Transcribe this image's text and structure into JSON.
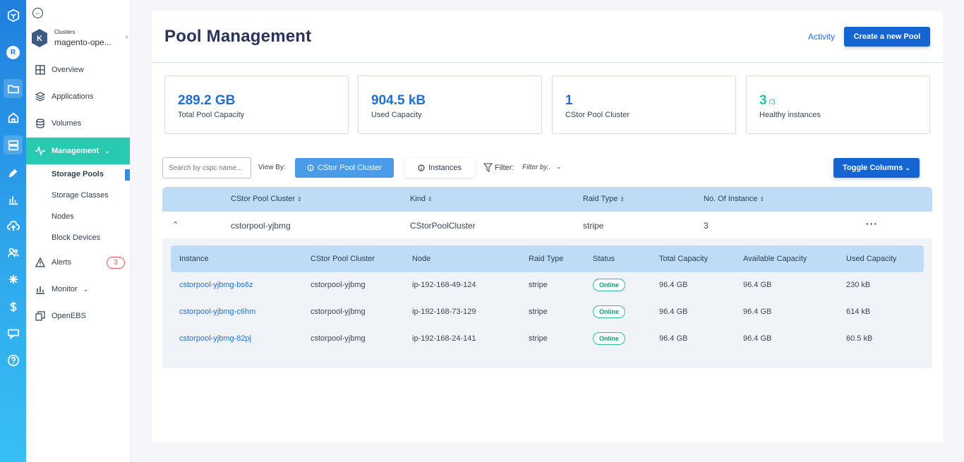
{
  "rail": {
    "avatar": "R",
    "items": [
      "logo-icon",
      "folder-icon",
      "home-icon",
      "server-icon",
      "satellite-icon",
      "bar-chart-icon",
      "cloud-upload-icon",
      "users-icon",
      "bug-icon",
      "dollar-icon",
      "chat-icon",
      "help-icon"
    ]
  },
  "sidebar": {
    "cluster_small": "Clusters",
    "cluster_name": "magento-ope...",
    "items": [
      {
        "label": "Overview",
        "icon": "grid-icon"
      },
      {
        "label": "Applications",
        "icon": "layers-icon"
      },
      {
        "label": "Volumes",
        "icon": "database-icon"
      },
      {
        "label": "Management",
        "icon": "pulse-icon"
      },
      {
        "label": "Alerts",
        "icon": "warning-icon"
      },
      {
        "label": "Monitor",
        "icon": "chart-icon"
      },
      {
        "label": "OpenEBS",
        "icon": "copy-icon"
      }
    ],
    "sub": [
      "Storage Pools",
      "Storage Classes",
      "Nodes",
      "Block Devices"
    ],
    "alerts_count": "3"
  },
  "header": {
    "title": "Pool Management",
    "activity": "Activity",
    "create": "Create a new Pool"
  },
  "stats": [
    {
      "value": "289.2 GB",
      "suffix": "",
      "label": "Total Pool Capacity"
    },
    {
      "value": "904.5 kB",
      "suffix": "",
      "label": "Used Capacity"
    },
    {
      "value": "1",
      "suffix": "",
      "label": "CStor Pool Cluster"
    },
    {
      "value": "3",
      "suffix": " /3",
      "label": "Healthy instances"
    }
  ],
  "toolbar": {
    "search_placeholder": "Search by cspc name...",
    "view_by": "View By:",
    "view_cluster": "CStor Pool Cluster",
    "view_instances": "Instances",
    "filter": "Filter:",
    "filter_value": "Filter by..",
    "toggle": "Toggle Columns"
  },
  "table": {
    "headers": [
      "CStor Pool Cluster",
      "Kind",
      "Raid Type",
      "No. Of Instance"
    ],
    "row": {
      "cluster": "cstorpool-yjbmg",
      "kind": "CStorPoolCluster",
      "raid": "stripe",
      "instances": "3"
    }
  },
  "subtable": {
    "headers": [
      "Instance",
      "CStor Pool Cluster",
      "Node",
      "Raid Type",
      "Status",
      "Total Capacity",
      "Available Capacity",
      "Used Capacity"
    ],
    "rows": [
      {
        "instance": "cstorpool-yjbmg-bs6z",
        "cluster": "cstorpool-yjbmg",
        "node": "ip-192-168-49-124",
        "raid": "stripe",
        "status": "Online",
        "total": "96.4 GB",
        "available": "96.4 GB",
        "used": "230 kB"
      },
      {
        "instance": "cstorpool-yjbmg-c6hm",
        "cluster": "cstorpool-yjbmg",
        "node": "ip-192-168-73-129",
        "raid": "stripe",
        "status": "Online",
        "total": "96.4 GB",
        "available": "96.4 GB",
        "used": "614 kB"
      },
      {
        "instance": "cstorpool-yjbmg-82pj",
        "cluster": "cstorpool-yjbmg",
        "node": "ip-192-168-24-141",
        "raid": "stripe",
        "status": "Online",
        "total": "96.4 GB",
        "available": "96.4 GB",
        "used": "60.5 kB"
      }
    ]
  },
  "colors": {
    "primary": "#1464d2",
    "accent": "#28c9b0",
    "header_row": "#bfdcf7"
  }
}
